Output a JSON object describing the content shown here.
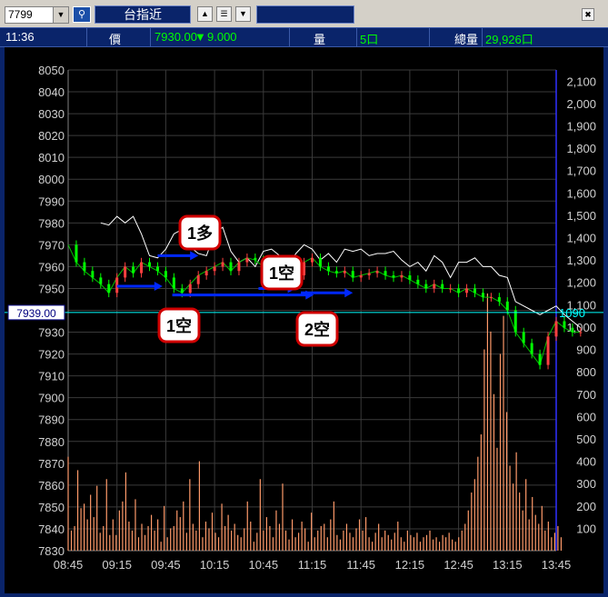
{
  "toolbar": {
    "code_value": "7799",
    "title": "台指近",
    "search_icon": "magnifier-icon",
    "icons": [
      "up-arrow-icon",
      "list-icon",
      "down-arrow-icon",
      "close-icon"
    ]
  },
  "infobar": {
    "time": "11:36",
    "price_label": "價",
    "price_value": "7930.00",
    "change_value": "9.000",
    "volume_label": "量",
    "volume_value": "5口",
    "total_label": "總量",
    "total_value": "29,926口"
  },
  "colors": {
    "background": "#000000",
    "grid": "#3a3a3a",
    "price_line": "#00c000",
    "ref_line": "#ffffff",
    "volume": "#ff9a6a",
    "up": "#ff4040",
    "down": "#00ff00",
    "cursor": "#00ffff",
    "arrow": "#0028ff",
    "callout": "#d00000",
    "axis_text": "#d0d0d0",
    "info_green": "#00ff00",
    "info_text": "#ffffff"
  },
  "chart_data": {
    "type": "line",
    "x_ticks": [
      "08:45",
      "09:15",
      "09:45",
      "10:15",
      "10:45",
      "11:15",
      "11:45",
      "12:15",
      "12:45",
      "13:15",
      "13:45"
    ],
    "y_left_ticks": [
      8050,
      8040,
      8030,
      8020,
      8010,
      8000,
      7990,
      7980,
      7970,
      7960,
      7950,
      7940,
      7930,
      7920,
      7910,
      7900,
      7890,
      7880,
      7870,
      7860,
      7850,
      7840,
      7830
    ],
    "y_left_range": [
      7830,
      8050
    ],
    "y_right_ticks": [
      "2,100",
      "2,000",
      "1,900",
      "1,800",
      "1,700",
      "1,600",
      "1,500",
      "1,400",
      "1,300",
      "1,200",
      "1,100",
      "1,000",
      "900",
      "800",
      "700",
      "600",
      "500",
      "400",
      "300",
      "200",
      "100"
    ],
    "y_right_range": [
      0,
      2150
    ],
    "cursor_price": "7939.00",
    "cursor_right": "1090",
    "cursor_value": 7939,
    "series": [
      {
        "role": "price",
        "x_minutes": [
          0,
          5,
          10,
          15,
          20,
          25,
          30,
          35,
          40,
          45,
          50,
          55,
          60,
          65,
          70,
          75,
          80,
          85,
          90,
          95,
          100,
          105,
          110,
          115,
          120,
          125,
          130,
          135,
          140,
          145,
          150,
          155,
          160,
          165,
          170,
          175,
          180,
          185,
          190,
          195,
          200,
          205,
          210,
          215,
          220,
          225,
          230,
          235,
          240,
          245,
          250,
          255,
          260,
          265,
          270,
          275,
          280,
          285,
          290,
          295,
          300,
          305,
          310,
          315
        ],
        "values": [
          7970,
          7962,
          7958,
          7955,
          7952,
          7948,
          7955,
          7960,
          7957,
          7962,
          7960,
          7958,
          7955,
          7950,
          7948,
          7952,
          7956,
          7958,
          7960,
          7962,
          7958,
          7962,
          7964,
          7963,
          7960,
          7958,
          7960,
          7958,
          7956,
          7962,
          7964,
          7960,
          7958,
          7957,
          7958,
          7955,
          7956,
          7957,
          7958,
          7956,
          7955,
          7956,
          7954,
          7952,
          7950,
          7952,
          7950,
          7950,
          7948,
          7950,
          7948,
          7946,
          7946,
          7944,
          7940,
          7930,
          7925,
          7920,
          7915,
          7928,
          7935,
          7932,
          7930,
          7930
        ]
      },
      {
        "role": "reference",
        "x_minutes": [
          20,
          25,
          30,
          35,
          40,
          45,
          50,
          55,
          60,
          65,
          70,
          75,
          80,
          85,
          90,
          95,
          100,
          105,
          110,
          115,
          120,
          125,
          130,
          135,
          140,
          145,
          150,
          155,
          160,
          165,
          170,
          175,
          180,
          185,
          190,
          195,
          200,
          205,
          210,
          215,
          220,
          225,
          230,
          235,
          240,
          245,
          250,
          255,
          260,
          265,
          270,
          275,
          280,
          285,
          290,
          295,
          300,
          305,
          310,
          315
        ],
        "values": [
          7980,
          7979,
          7983,
          7980,
          7983,
          7975,
          7965,
          7964,
          7968,
          7975,
          7977,
          7969,
          7966,
          7965,
          7975,
          7978,
          7967,
          7962,
          7964,
          7960,
          7967,
          7968,
          7965,
          7960,
          7966,
          7970,
          7968,
          7963,
          7966,
          7962,
          7968,
          7967,
          7968,
          7965,
          7966,
          7966,
          7967,
          7963,
          7960,
          7962,
          7958,
          7965,
          7962,
          7955,
          7962,
          7962,
          7964,
          7960,
          7960,
          7956,
          7955,
          7944,
          7942,
          7940,
          7938,
          7940,
          7942,
          7938,
          7935,
          7932
        ]
      }
    ],
    "volume_values": [
      420,
      90,
      110,
      360,
      190,
      210,
      140,
      250,
      150,
      290,
      80,
      110,
      320,
      70,
      140,
      70,
      180,
      220,
      350,
      130,
      90,
      230,
      60,
      120,
      70,
      110,
      160,
      90,
      140,
      40,
      200,
      60,
      100,
      110,
      180,
      150,
      220,
      80,
      320,
      120,
      90,
      400,
      60,
      130,
      100,
      170,
      80,
      60,
      210,
      110,
      160,
      90,
      120,
      70,
      60,
      100,
      220,
      130,
      40,
      80,
      320,
      90,
      150,
      110,
      60,
      180,
      120,
      300,
      90,
      50,
      140,
      60,
      80,
      130,
      100,
      40,
      170,
      60,
      90,
      110,
      120,
      60,
      140,
      220,
      70,
      50,
      90,
      120,
      80,
      60,
      100,
      140,
      90,
      150,
      60,
      40,
      80,
      120,
      60,
      90,
      70,
      50,
      80,
      130,
      60,
      40,
      90,
      70,
      60,
      80,
      40,
      60,
      70,
      90,
      50,
      60,
      40,
      70,
      60,
      80,
      50,
      40,
      60,
      90,
      120,
      180,
      260,
      320,
      420,
      520,
      900,
      1150,
      980,
      700,
      460,
      880,
      1050,
      620,
      380,
      300,
      440,
      260,
      180,
      320,
      140,
      240,
      160,
      120,
      200,
      90,
      130,
      60,
      80,
      110,
      60
    ]
  },
  "annotations": {
    "callouts": [
      "1多",
      "1空",
      "1空",
      "2空"
    ]
  }
}
